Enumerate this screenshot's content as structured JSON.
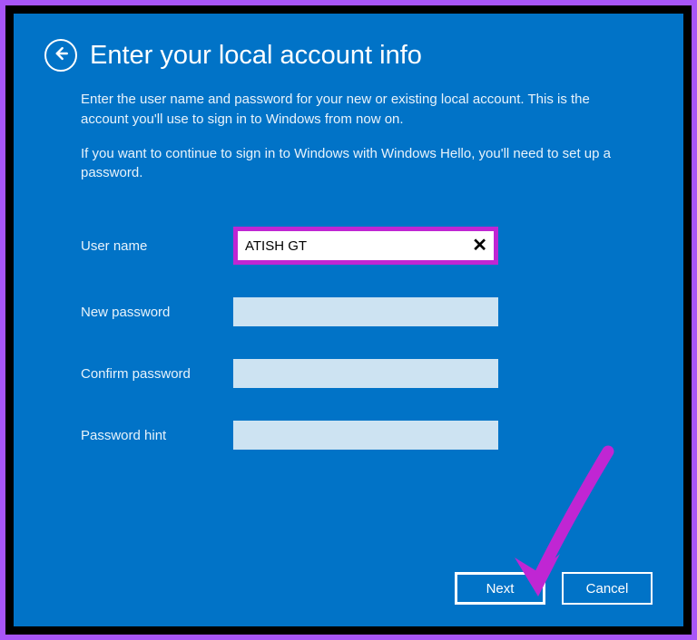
{
  "title": "Enter your local account info",
  "description1": "Enter the user name and password for your new or existing local account. This is the account you'll use to sign in to Windows from now on.",
  "description2": "If you want to continue to sign in to Windows with Windows Hello, you'll need to set up a password.",
  "labels": {
    "username": "User name",
    "newPassword": "New password",
    "confirmPassword": "Confirm password",
    "passwordHint": "Password hint"
  },
  "values": {
    "username": "ATISH GT"
  },
  "buttons": {
    "next": "Next",
    "cancel": "Cancel"
  }
}
